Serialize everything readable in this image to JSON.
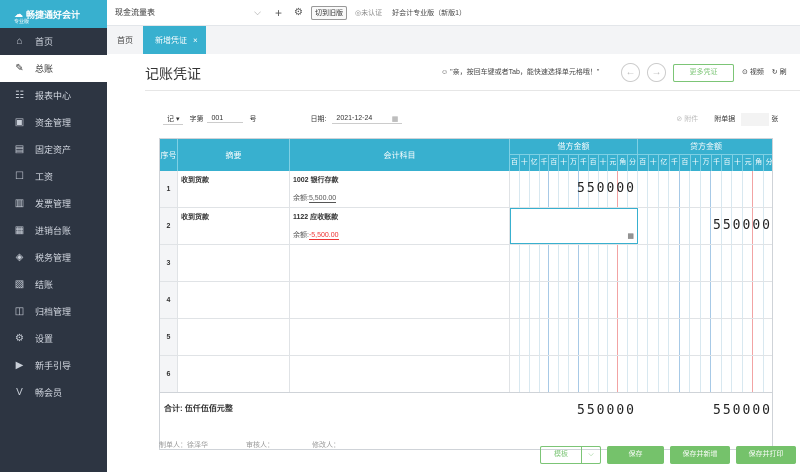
{
  "app": {
    "name": "畅捷通好会计",
    "edition_badge": "专业版"
  },
  "sidebar": {
    "items": [
      {
        "label": "首页",
        "icon": "home-icon",
        "glyph": "⌂"
      },
      {
        "label": "总账",
        "icon": "ledger-icon",
        "glyph": "✎"
      },
      {
        "label": "报表中心",
        "icon": "chart-icon",
        "glyph": "☷"
      },
      {
        "label": "资金管理",
        "icon": "wallet-icon",
        "glyph": "▣"
      },
      {
        "label": "固定资产",
        "icon": "asset-icon",
        "glyph": "▤"
      },
      {
        "label": "工资",
        "icon": "salary-icon",
        "glyph": "☐"
      },
      {
        "label": "发票管理",
        "icon": "invoice-icon",
        "glyph": "▥"
      },
      {
        "label": "进销台账",
        "icon": "inventory-icon",
        "glyph": "▦"
      },
      {
        "label": "税务管理",
        "icon": "tax-icon",
        "glyph": "◈"
      },
      {
        "label": "结账",
        "icon": "close-book-icon",
        "glyph": "▧"
      },
      {
        "label": "归档管理",
        "icon": "archive-icon",
        "glyph": "◫"
      },
      {
        "label": "设置",
        "icon": "settings-icon",
        "glyph": "⚙"
      },
      {
        "label": "新手引导",
        "icon": "guide-icon",
        "glyph": "▶"
      },
      {
        "label": "畅会员",
        "icon": "vip-icon",
        "glyph": "V"
      }
    ],
    "active_index": 1
  },
  "topbar": {
    "account_select": "现金流量表",
    "switch_button": "切到旧版",
    "cert_status": "未认证",
    "edition": "好会计专业版（新版1）"
  },
  "tabs": [
    {
      "label": "首页",
      "active": false
    },
    {
      "label": "新增凭证",
      "active": true,
      "close": "×"
    }
  ],
  "voucher": {
    "title": "记账凭证",
    "tip": "\"亲，按回车键或者Tab，能快速选择单元格哦！\"",
    "more_button": "更多凭证",
    "video_label": "视频",
    "refresh_label": "刷",
    "type": "记",
    "num_prefix": "字第",
    "number": "001",
    "num_suffix": "号",
    "date_label": "日期:",
    "date": "2021-12-24",
    "attachment_label": "附件",
    "attach_docs_label": "附单据",
    "attach_docs_unit": "张"
  },
  "table": {
    "headers": {
      "seq": "序号",
      "summary": "摘要",
      "account": "会计科目",
      "debit": "借方金额",
      "credit": "贷方金额"
    },
    "digit_labels": [
      "百",
      "十",
      "亿",
      "千",
      "百",
      "十",
      "万",
      "千",
      "百",
      "十",
      "元",
      "角",
      "分"
    ],
    "rows": [
      {
        "seq": "1",
        "summary": "收到货款",
        "account": "1002 银行存款",
        "balance_label": "余额:",
        "balance": "5,500.00",
        "negative": false,
        "debit": "550000",
        "credit": ""
      },
      {
        "seq": "2",
        "summary": "收到货款",
        "account": "1122 应收账款",
        "balance_label": "余额:",
        "balance": "-5,500.00",
        "negative": true,
        "debit": "",
        "credit": "550000"
      },
      {
        "seq": "3",
        "summary": "",
        "account": "",
        "debit": "",
        "credit": ""
      },
      {
        "seq": "4",
        "summary": "",
        "account": "",
        "debit": "",
        "credit": ""
      },
      {
        "seq": "5",
        "summary": "",
        "account": "",
        "debit": "",
        "credit": ""
      },
      {
        "seq": "6",
        "summary": "",
        "account": "",
        "debit": "",
        "credit": ""
      }
    ],
    "total_label": "合计:",
    "total_text": "伍仟伍佰元整",
    "total_debit": "550000",
    "total_credit": "550000"
  },
  "footer": {
    "maker": "制单人：徐泽华",
    "reviewer": "审核人：",
    "modifier": "修改人："
  },
  "actions": {
    "template": "模板",
    "save": "保存",
    "save_new": "保存并新增",
    "save_print": "保存并打印"
  },
  "colors": {
    "accent": "#38b0cf",
    "sidebar": "#2d3542",
    "green": "#75c26b",
    "negative": "#e33333"
  }
}
